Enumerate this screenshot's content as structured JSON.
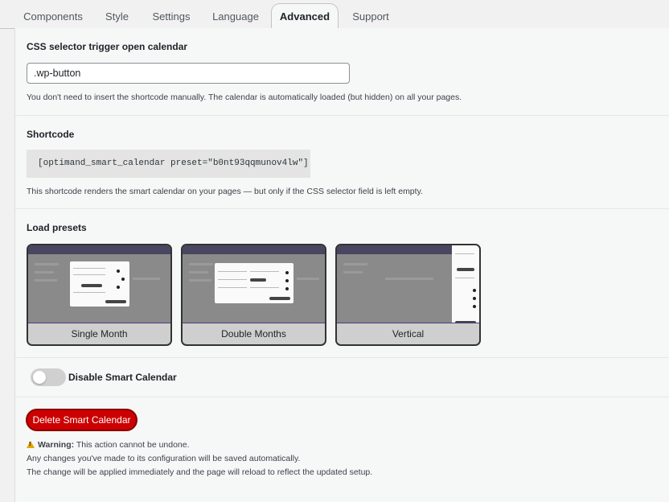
{
  "tabs": [
    "Components",
    "Style",
    "Settings",
    "Language",
    "Advanced",
    "Support"
  ],
  "css_selector": {
    "heading": "CSS selector trigger open calendar",
    "value": ".wp-button",
    "help": "You don't need to insert the shortcode manually. The calendar is automatically loaded (but hidden) on all your pages."
  },
  "shortcode": {
    "heading": "Shortcode",
    "code": "[optimand_smart_calendar preset=\"b0nt93qqmunov4lw\"]",
    "help": "This shortcode renders the smart calendar on your pages — but only if the CSS selector field is left empty."
  },
  "presets": {
    "heading": "Load presets",
    "items": [
      "Single Month",
      "Double Months",
      "Vertical"
    ]
  },
  "disable_toggle": {
    "label": "Disable Smart Calendar",
    "checked": false
  },
  "delete": {
    "button_label": "Delete Smart Calendar",
    "warning_label": "Warning:",
    "warning_text": "This action cannot be undone.",
    "line2": "Any changes you've made to its configuration will be saved automatically.",
    "line3": "The change will be applied immediately and the page will reload to reflect the updated setup."
  },
  "colors": {
    "danger": "#cc0000",
    "toggle_off": "#d0d0d0",
    "warning_icon": "#e2a400"
  }
}
